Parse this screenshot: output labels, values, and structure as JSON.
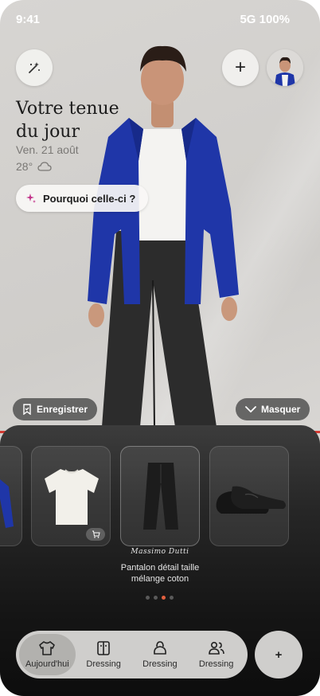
{
  "status_bar": {
    "time": "9:41",
    "network": "5G 100%"
  },
  "header": {
    "title_line1": "Votre tenue",
    "title_line2": "du jour",
    "date": "Ven. 21 août",
    "temperature": "28°",
    "weather_icon": "cloud-icon",
    "why_button": "Pourquoi celle-ci ?",
    "magic_icon": "magic-wand-icon",
    "add_label": "+"
  },
  "actions": {
    "save": "Enregistrer",
    "hide": "Masquer"
  },
  "carousel": {
    "items": [
      {
        "name": "jacket-partial"
      },
      {
        "name": "tshirt",
        "has_cart_badge": true
      },
      {
        "name": "trousers"
      },
      {
        "name": "loafers"
      }
    ],
    "brand": "Massimo Dutti",
    "product_name": "Pantalon détail taille mélange coton",
    "page_count": 4,
    "active_page": 3
  },
  "tabbar": {
    "tabs": [
      {
        "label": "Aujourd'hui",
        "icon": "tshirt-icon",
        "active": true
      },
      {
        "label": "Dressing",
        "icon": "wardrobe-icon",
        "active": false
      },
      {
        "label": "Dressing",
        "icon": "bag-icon",
        "active": false
      },
      {
        "label": "Dressing",
        "icon": "people-icon",
        "active": false
      }
    ],
    "fab_label": "+"
  },
  "colors": {
    "accent": "#e2603f",
    "jacket": "#1f36a8",
    "red_line": "#d23a32"
  }
}
